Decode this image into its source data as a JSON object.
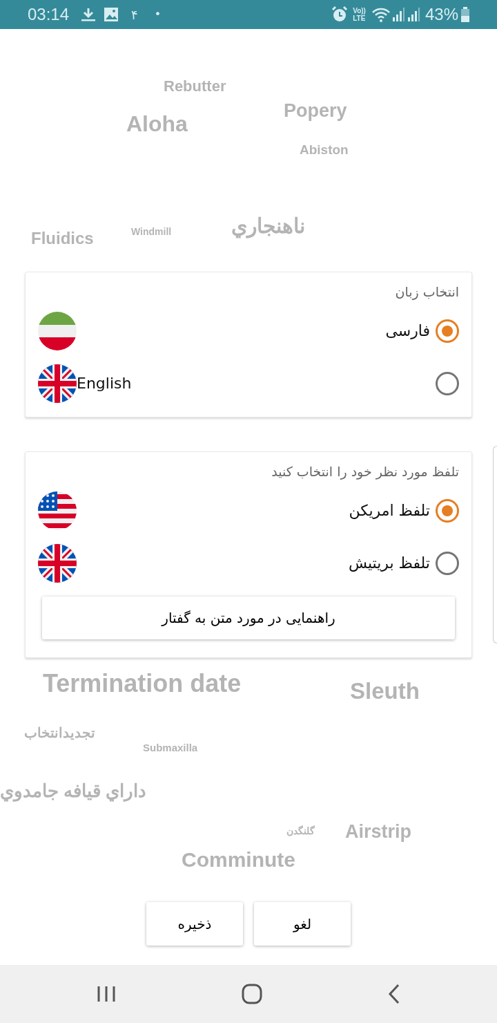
{
  "status_bar": {
    "time": "03:14",
    "notification_digit": "۴",
    "notification_dot": "•",
    "volte": [
      "Vo))",
      "LTE"
    ],
    "battery_text": "43%"
  },
  "background_words": [
    "Rebutter",
    "Aloha",
    "Popery",
    "Abiston",
    "Fluidics",
    "ناهنجاري",
    "Windmill",
    "Termination date",
    "Sleuth",
    "تجدیدانتخاب",
    "Submaxilla",
    "داراي قيافه جامدوي",
    "گلنگدن",
    "Airstrip",
    "Comminute"
  ],
  "language_card": {
    "title": "انتخاب زبان",
    "options": [
      {
        "kind": "radio-label",
        "label": "فارسی",
        "flag": {
          "kind": "iran"
        },
        "selected": true
      },
      {
        "kind": "flag-label",
        "label": "English",
        "flag": {
          "kind": "uk"
        },
        "selected": false
      }
    ]
  },
  "pronunciation_card": {
    "title": "تلفظ مورد نظر خود را انتخاب کنید",
    "options": [
      {
        "kind": "radio-label",
        "label": "تلفظ امریکن",
        "flag": {
          "kind": "us"
        },
        "selected": true
      },
      {
        "kind": "radio-label",
        "label": "تلفظ بریتیش",
        "flag": {
          "kind": "uk"
        },
        "selected": false
      }
    ],
    "help_button": "راهنمایی در مورد متن به گفتار"
  },
  "buttons": [
    "لغو",
    "ذخیره"
  ]
}
